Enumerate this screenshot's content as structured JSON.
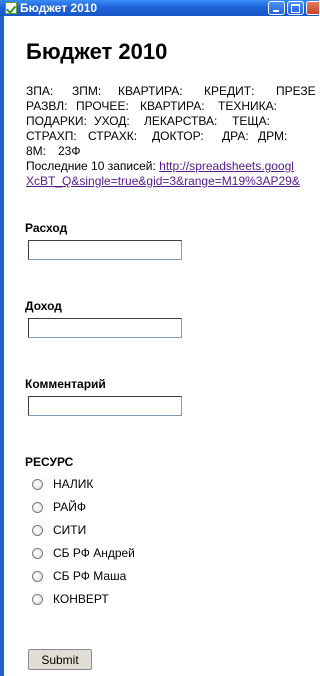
{
  "window": {
    "title": "Бюджет 2010"
  },
  "page": {
    "title": "Бюджет 2010",
    "summary_rows": [
      [
        "ЗПА:",
        "ЗПМ:",
        "КВАРТИРА:",
        "КРЕДИТ:",
        "ПРЕЗЕ"
      ],
      [
        "РАЗВЛ:",
        "ПРОЧЕЕ:",
        "КВАРТИРА:",
        "ТЕХНИКА:"
      ],
      [
        "ПОДАРКИ:",
        "УХОД:",
        "ЛЕКАРСТВА:",
        "ТЕЩА:"
      ],
      [
        "СТРАХП:",
        "СТРАХК:",
        "ДОКТОР:",
        "ДРА:",
        "ДРМ:"
      ],
      [
        "8М:",
        "23Ф"
      ]
    ],
    "last_records_prefix": "Последние 10 записей:",
    "link_line1": "http://spreadsheets.googl",
    "link_line2": "XcBT_Q&single=true&gid=3&range=M19%3AP29&"
  },
  "form": {
    "expense_label": "Расход",
    "expense_value": "",
    "income_label": "Доход",
    "income_value": "",
    "comment_label": "Комментарий",
    "comment_value": "",
    "resource_label": "РЕСУРС",
    "resource_options": [
      "НАЛИК",
      "РАЙФ",
      "СИТИ",
      "СБ РФ Андрей",
      "СБ РФ Маша",
      "КОНВЕРТ"
    ],
    "submit_label": "Submit"
  }
}
